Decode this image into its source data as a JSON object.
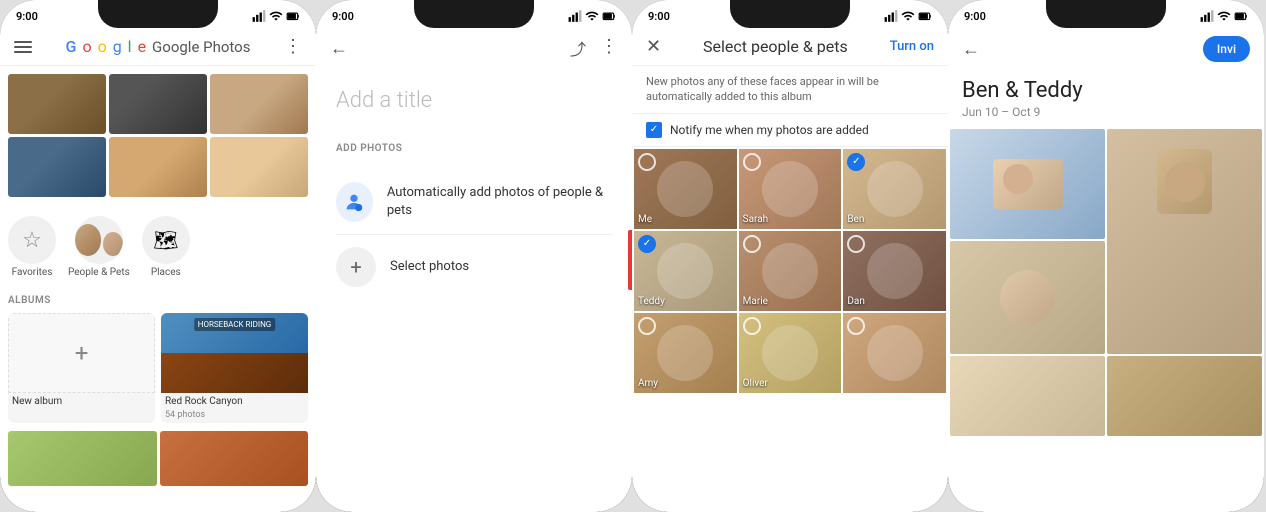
{
  "phone1": {
    "status_time": "9:00",
    "app_name": "Google Photos",
    "menu_icon": "≡",
    "more_icon": "⋮",
    "logo_letters": [
      {
        "char": "G",
        "color": "#4285F4"
      },
      {
        "char": "o",
        "color": "#EA4335"
      },
      {
        "char": "o",
        "color": "#FBBC05"
      },
      {
        "char": "g",
        "color": "#4285F4"
      },
      {
        "char": "l",
        "color": "#34A853"
      },
      {
        "char": "e",
        "color": "#EA4335"
      }
    ],
    "categories": [
      {
        "label": "Favorites"
      },
      {
        "label": "People & Pets"
      },
      {
        "label": "Places"
      }
    ],
    "albums_label": "ALBUMS",
    "new_album_label": "New album",
    "album_name": "Red Rock Canyon",
    "album_count": "54 photos"
  },
  "phone2": {
    "status_time": "9:00",
    "back_icon": "←",
    "share_icon": "⤴",
    "more_icon": "⋮",
    "title_placeholder": "Add a title",
    "add_photos_label": "ADD PHOTOS",
    "auto_add_text": "Automatically add photos of people & pets",
    "select_photos_text": "Select photos"
  },
  "phone3": {
    "status_time": "9:00",
    "close_icon": "✕",
    "title": "Select people & pets",
    "turn_on_label": "Turn on",
    "subtitle": "New photos any of these faces appear in will be automatically added to this album",
    "notify_label": "Notify me when my photos are added",
    "people": [
      {
        "name": "Me",
        "selected": false
      },
      {
        "name": "Sarah",
        "selected": false
      },
      {
        "name": "Ben",
        "selected": true
      },
      {
        "name": "Teddy",
        "selected": true
      },
      {
        "name": "Marie",
        "selected": false
      },
      {
        "name": "Dan",
        "selected": false
      },
      {
        "name": "Amy",
        "selected": false
      },
      {
        "name": "Oliver",
        "selected": false
      },
      {
        "name": "",
        "selected": false
      }
    ]
  },
  "phone4": {
    "status_time": "9:00",
    "back_icon": "←",
    "invite_label": "Invi",
    "album_title": "Ben & Teddy",
    "album_dates": "Jun 10 – Oct 9"
  }
}
